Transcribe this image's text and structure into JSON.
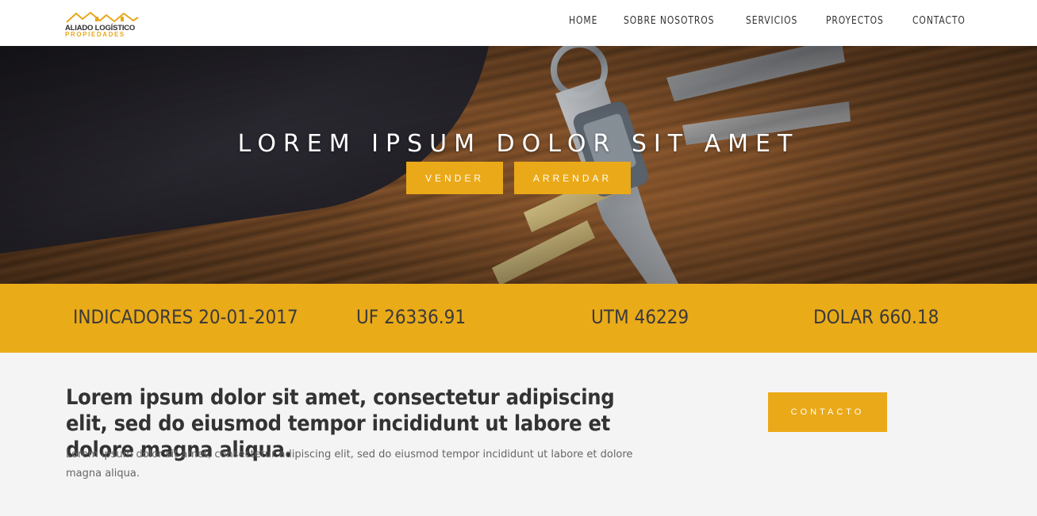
{
  "header": {
    "logo": {
      "line1": "ALIADO LOGÍSTICO",
      "line2": "PROPIEDADES"
    },
    "nav": [
      {
        "label": "HOME"
      },
      {
        "label": "SOBRE NOSOTROS"
      },
      {
        "label": "SERVICIOS"
      },
      {
        "label": "PROYECTOS"
      },
      {
        "label": "CONTACTO"
      }
    ]
  },
  "hero": {
    "title": "LOREM IPSUM DOLOR SIT AMET",
    "buttons": {
      "vender": "VENDER",
      "arrendar": "ARRENDAR"
    }
  },
  "indicators": [
    {
      "label": "INDICADORES 20-01-2017"
    },
    {
      "label": "UF 26336.91"
    },
    {
      "label": "UTM 46229"
    },
    {
      "label": "DOLAR 660.18"
    }
  ],
  "content": {
    "lead": "Lorem ipsum dolor sit amet, consectetur adipiscing elit, sed do eiusmod tempor incididunt ut labore et dolore magna aliqua.",
    "paragraph": "Lorem ipsum dolor sit amet, consectetur adipiscing elit, sed do eiusmod tempor incididunt ut labore et dolore magna aliqua.",
    "contact_button": "CONTACTO"
  },
  "colors": {
    "accent": "#eaa918",
    "header_bg": "#ffffff",
    "content_bg": "#f4f4f4"
  }
}
